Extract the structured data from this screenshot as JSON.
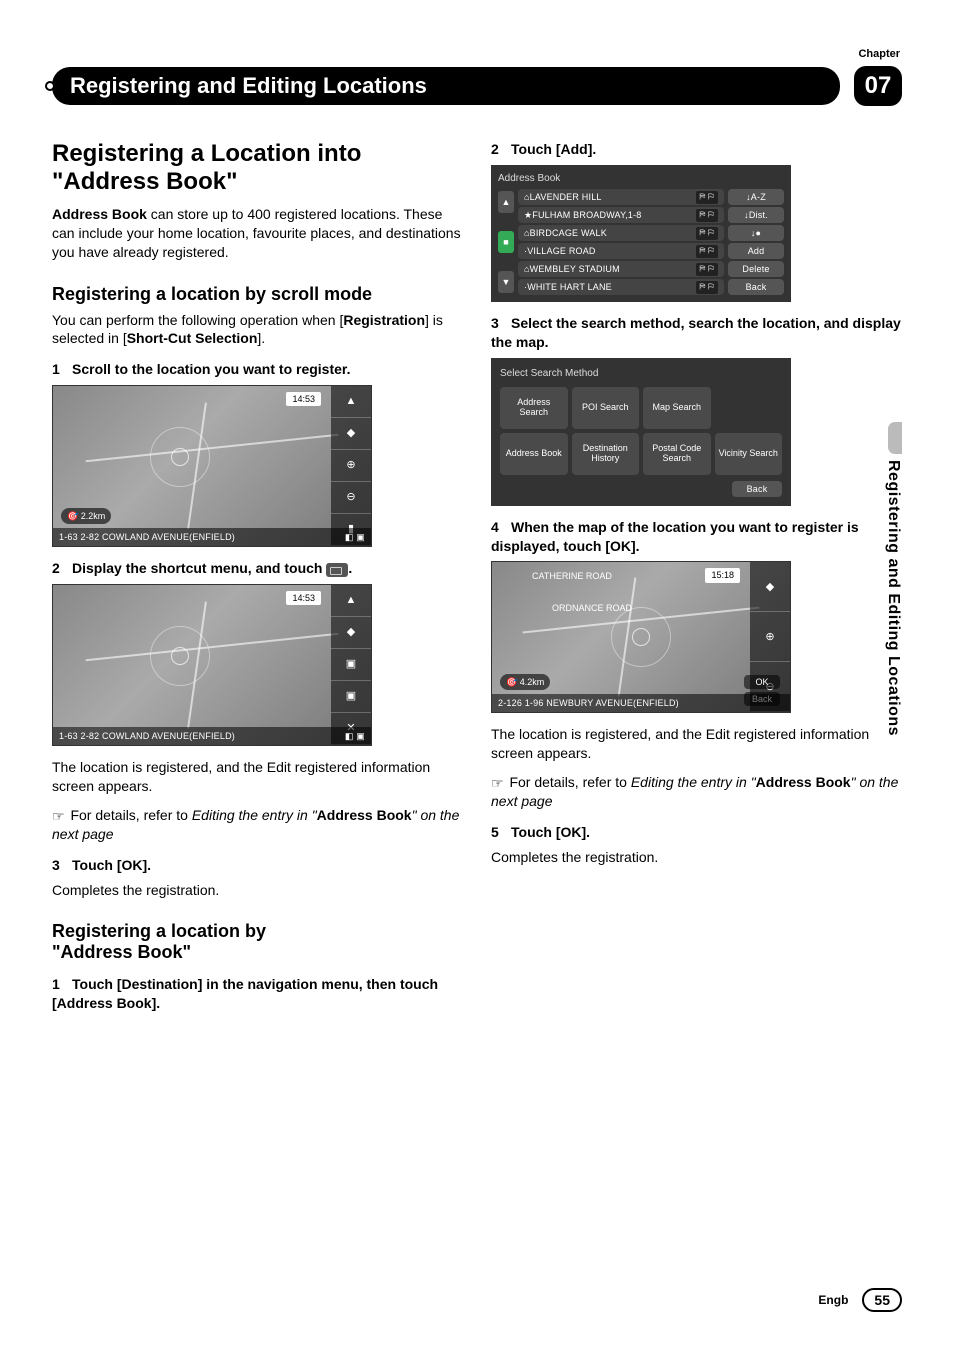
{
  "meta": {
    "chapterLabel": "Chapter",
    "chapterNumber": "07",
    "headerTitle": "Registering and Editing Locations",
    "sideTab": "Registering and Editing Locations",
    "footerLang": "Engb",
    "pageNumber": "55"
  },
  "mapShot1": {
    "time": "14:53",
    "distance": "2.2km",
    "address": "1-63 2-82 COWLAND AVENUE(ENFIELD)"
  },
  "mapShot2": {
    "time": "14:53",
    "distance": "",
    "address": "1-63 2-82 COWLAND AVENUE(ENFIELD)"
  },
  "addressBookShot": {
    "title": "Address Book",
    "rows": [
      "LAVENDER HILL",
      "FULHAM BROADWAY,1-8",
      "BIRDCAGE WALK",
      "VILLAGE ROAD",
      "WEMBLEY STADIUM",
      "WHITE HART LANE"
    ],
    "sideButtons": [
      "A-Z",
      "Dist.",
      "●",
      "Add",
      "Delete",
      "Back"
    ]
  },
  "searchMethodShot": {
    "title": "Select Search Method",
    "cells": [
      "Address Search",
      "POI Search",
      "Map Search",
      "",
      "Address Book",
      "Destination History",
      "Postal Code Search",
      "Vicinity Search"
    ],
    "back": "Back"
  },
  "mapShot3": {
    "time": "15:18",
    "distance": "4.2km",
    "address": "2-126 1-96 NEWBURY AVENUE(ENFIELD)",
    "road1": "CATHERINE ROAD",
    "road2": "ORDNANCE ROAD",
    "ok": "OK",
    "backBtn": "Back"
  },
  "left": {
    "h1a": "Registering a Location into",
    "h1b": "\"Address Book\"",
    "introA": "Address Book",
    "introB": " can store up to 400 registered locations. These can include your home location, favourite places, and destinations you have already registered.",
    "h2scroll": "Registering a location by scroll mode",
    "scrollPara1a": "You can perform the following operation when [",
    "scrollPara1b": "Registration",
    "scrollPara1c": "] is selected in [",
    "scrollPara1d": "Short-Cut Selection",
    "scrollPara1e": "].",
    "step1": "Scroll to the location you want to register.",
    "step2": "Display the shortcut menu, and touch ",
    "step2end": ".",
    "afterMapA": "The location is registered, and the Edit registered information screen appears.",
    "crossRefA": "For details, refer to ",
    "crossRefB": "Editing the entry in \"",
    "crossRefC": "Address Book",
    "crossRefD": "\" on the next page",
    "step3": "Touch [OK].",
    "step3body": "Completes the registration.",
    "h2abA": "Registering a location by",
    "h2abB": "\"Address Book\"",
    "abStep1": "Touch [Destination] in the navigation menu, then touch [Address Book]."
  },
  "right": {
    "step2": "Touch [Add].",
    "step3": "Select the search method, search the location, and display the map.",
    "step4": "When the map of the location you want to register is displayed, touch [OK].",
    "afterMapA": "The location is registered, and the Edit registered information screen appears.",
    "crossRefA": "For details, refer to ",
    "crossRefB": "Editing the entry in \"",
    "crossRefC": "Address Book",
    "crossRefD": "\" on the next page",
    "step5": "Touch [OK].",
    "step5body": "Completes the registration."
  }
}
